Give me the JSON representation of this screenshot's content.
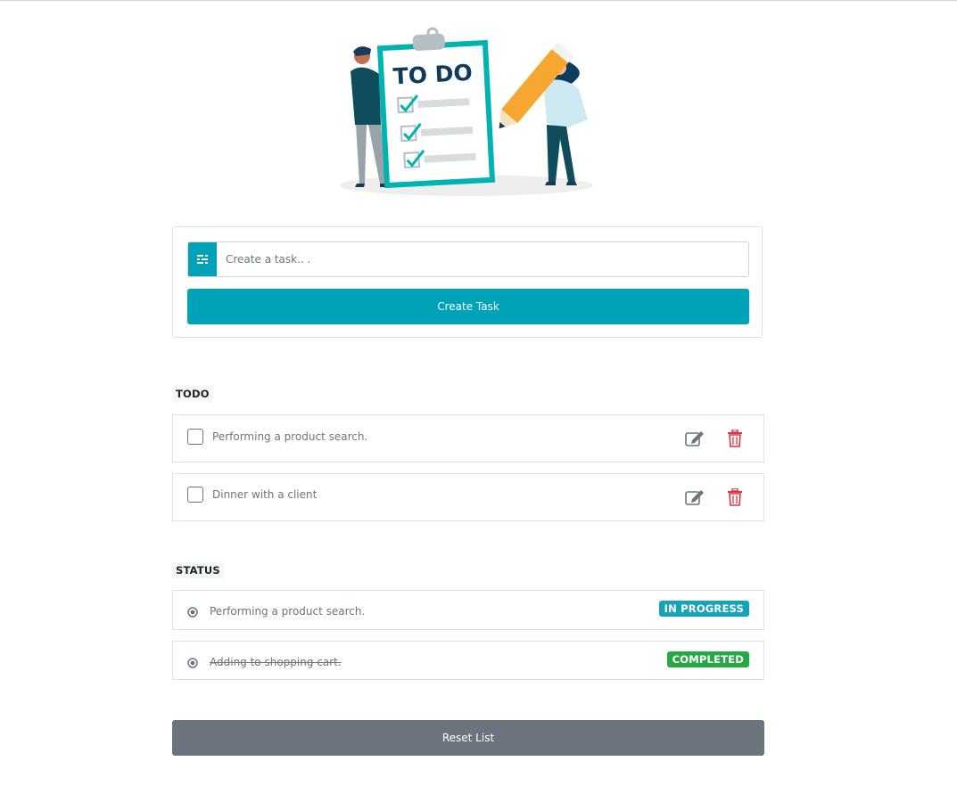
{
  "hero": {
    "board_text": "TO DO"
  },
  "create": {
    "input_placeholder": "Create a task.. .",
    "input_value": "",
    "button_label": "Create Task"
  },
  "todo": {
    "title": "TODO",
    "items": [
      {
        "text": "Performing a product search.",
        "checked": false
      },
      {
        "text": "Dinner with a client",
        "checked": false
      }
    ]
  },
  "status": {
    "title": "STATUS",
    "items": [
      {
        "text": "Performing a product search.",
        "badge": "IN PROGRESS",
        "badge_color": "#17a2b8",
        "completed": false
      },
      {
        "text": "Adding to shopping cart.",
        "badge": "COMPLETED",
        "badge_color": "#28a745",
        "completed": true
      }
    ]
  },
  "reset": {
    "label": "Reset List"
  },
  "colors": {
    "primary": "#00a2b8",
    "danger": "#dc3545",
    "secondary": "#6c757d"
  },
  "icons": {
    "input_addon": "list-icon",
    "edit": "edit-icon",
    "delete": "trash-icon",
    "status": "radio-dot-icon"
  }
}
